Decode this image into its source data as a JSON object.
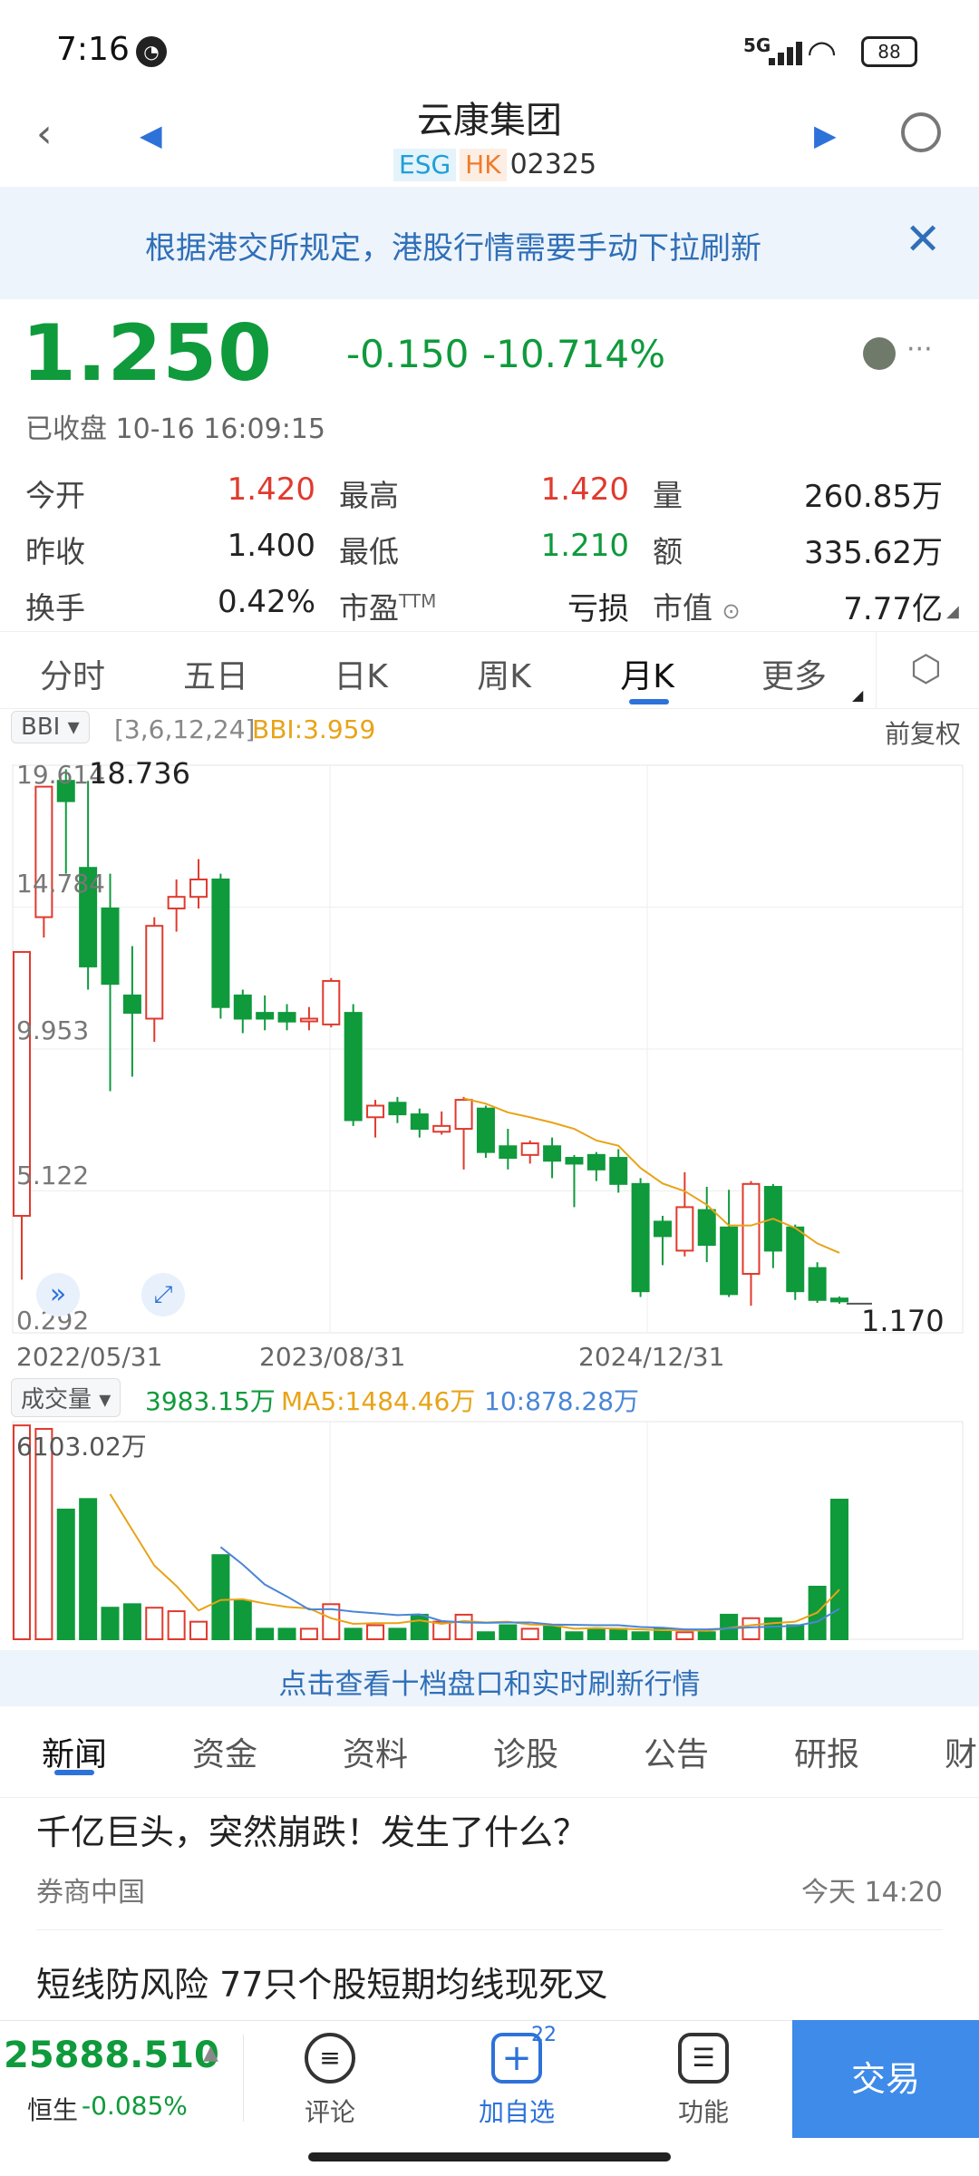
{
  "status": {
    "time": "7:16",
    "signal": "5G",
    "battery": "88"
  },
  "header": {
    "title": "云康集团",
    "tags": [
      "ESG",
      "HK"
    ],
    "code": "02325"
  },
  "notice": {
    "text": "根据港交所规定，港股行情需要手动下拉刷新"
  },
  "quote": {
    "price": "1.250",
    "change": "-0.150",
    "change_pct": "-10.714%",
    "closed_label": "已收盘 10-16 16:09:15",
    "rows": [
      {
        "l1": "今开",
        "v1": "1.420",
        "l2": "最高",
        "v2": "1.420",
        "l3": "量",
        "v3": "260.85万"
      },
      {
        "l1": "昨收",
        "v1": "1.400",
        "l2": "最低",
        "v2": "1.210",
        "l3": "额",
        "v3": "335.62万"
      },
      {
        "l1": "换手",
        "v1": "0.42%",
        "l2": "市盈",
        "l2sup": "TTM",
        "v2": "亏损",
        "l3": "市值",
        "v3": "7.77亿"
      }
    ],
    "colors": {
      "up": "#e03a2e",
      "down": "#0f9a3c"
    }
  },
  "tabs": [
    "分时",
    "五日",
    "日K",
    "周K",
    "月K",
    "更多"
  ],
  "active_tab": "月K",
  "chart_bar": {
    "indicator": "BBI",
    "params": "[3,6,12,24]",
    "bbi_value": "BBI:3.959",
    "adjust": "前复权"
  },
  "price_chart": {
    "y_labels": [
      "19.614",
      "14.784",
      "9.953",
      "5.122",
      "0.292"
    ],
    "high_label": "18.736",
    "low_label": "1.170",
    "x_labels": [
      "2022/05/31",
      "2023/08/31",
      "2024/12/31"
    ]
  },
  "volume_bar": {
    "label": "成交量",
    "vol": "3983.15万",
    "ma5": "MA5:1484.46万",
    "ma10": "10:878.28万",
    "max_label": "6103.02万"
  },
  "chart_data": {
    "type": "candlestick",
    "x": [
      "2022/05/31",
      "2023/08/31",
      "2024/12/31"
    ],
    "ylim": [
      0.292,
      19.614
    ],
    "candles": [
      {
        "o": 4.2,
        "c": 13.3,
        "h": 13.3,
        "l": 2.0
      },
      {
        "o": 14.5,
        "c": 19.0,
        "h": 19.0,
        "l": 13.8
      },
      {
        "o": 19.2,
        "c": 18.5,
        "h": 19.6,
        "l": 16.0
      },
      {
        "o": 16.2,
        "c": 12.8,
        "h": 19.2,
        "l": 12.0
      },
      {
        "o": 14.8,
        "c": 12.2,
        "h": 16.0,
        "l": 8.5
      },
      {
        "o": 11.8,
        "c": 11.2,
        "h": 13.5,
        "l": 9.0
      },
      {
        "o": 11.0,
        "c": 14.2,
        "h": 14.5,
        "l": 10.2
      },
      {
        "o": 14.8,
        "c": 15.2,
        "h": 15.8,
        "l": 14.0
      },
      {
        "o": 15.2,
        "c": 15.8,
        "h": 16.5,
        "l": 14.8
      },
      {
        "o": 15.8,
        "c": 11.4,
        "h": 16.0,
        "l": 11.0
      },
      {
        "o": 11.8,
        "c": 11.0,
        "h": 12.0,
        "l": 10.5
      },
      {
        "o": 11.2,
        "c": 11.0,
        "h": 11.8,
        "l": 10.6
      },
      {
        "o": 11.2,
        "c": 10.9,
        "h": 11.5,
        "l": 10.6
      },
      {
        "o": 11.0,
        "c": 11.0,
        "h": 11.4,
        "l": 10.6
      },
      {
        "o": 10.8,
        "c": 12.3,
        "h": 12.4,
        "l": 10.7
      },
      {
        "o": 11.2,
        "c": 7.5,
        "h": 11.5,
        "l": 7.3
      },
      {
        "o": 7.6,
        "c": 8.0,
        "h": 8.2,
        "l": 6.9
      },
      {
        "o": 8.1,
        "c": 7.7,
        "h": 8.3,
        "l": 7.4
      },
      {
        "o": 7.7,
        "c": 7.2,
        "h": 7.9,
        "l": 6.9
      },
      {
        "o": 7.1,
        "c": 7.3,
        "h": 7.8,
        "l": 7.0
      },
      {
        "o": 7.2,
        "c": 8.2,
        "h": 8.3,
        "l": 5.8
      },
      {
        "o": 7.9,
        "c": 6.4,
        "h": 8.0,
        "l": 6.2
      },
      {
        "o": 6.6,
        "c": 6.2,
        "h": 7.2,
        "l": 5.8
      },
      {
        "o": 6.3,
        "c": 6.7,
        "h": 6.8,
        "l": 6.0
      },
      {
        "o": 6.6,
        "c": 6.1,
        "h": 6.9,
        "l": 5.5
      },
      {
        "o": 6.2,
        "c": 6.0,
        "h": 6.3,
        "l": 4.5
      },
      {
        "o": 6.3,
        "c": 5.8,
        "h": 6.4,
        "l": 5.4
      },
      {
        "o": 6.2,
        "c": 5.3,
        "h": 6.5,
        "l": 5.0
      },
      {
        "o": 5.3,
        "c": 1.6,
        "h": 5.5,
        "l": 1.4
      },
      {
        "o": 4.0,
        "c": 3.5,
        "h": 4.2,
        "l": 2.5
      },
      {
        "o": 3.0,
        "c": 4.5,
        "h": 5.7,
        "l": 2.8
      },
      {
        "o": 4.4,
        "c": 3.2,
        "h": 5.2,
        "l": 2.6
      },
      {
        "o": 3.8,
        "c": 1.5,
        "h": 5.1,
        "l": 1.4
      },
      {
        "o": 2.2,
        "c": 5.3,
        "h": 5.4,
        "l": 1.1
      },
      {
        "o": 5.2,
        "c": 3.0,
        "h": 5.3,
        "l": 2.4
      },
      {
        "o": 3.8,
        "c": 1.6,
        "h": 3.9,
        "l": 1.3
      },
      {
        "o": 2.4,
        "c": 1.3,
        "h": 2.6,
        "l": 1.2
      },
      {
        "o": 1.35,
        "c": 1.25,
        "h": 1.42,
        "l": 1.17
      }
    ],
    "volume_max": 6103.02
  },
  "newsbar": {
    "text": "点击查看十档盘口和实时刷新行情"
  },
  "news_tabs": [
    "新闻",
    "资金",
    "资料",
    "诊股",
    "公告",
    "研报",
    "财"
  ],
  "news": [
    {
      "title": "千亿巨头，突然崩跌！发生了什么？",
      "source": "券商中国",
      "time": "今天 14:20"
    },
    {
      "title": "短线防风险 77只个股短期均线现死叉"
    }
  ],
  "bottom": {
    "index_value": "25888.510",
    "index_name": "恒生",
    "index_change": "-0.085%",
    "comment": "评论",
    "add_watch": "加自选",
    "badge": "22",
    "func": "功能",
    "trade": "交易"
  }
}
